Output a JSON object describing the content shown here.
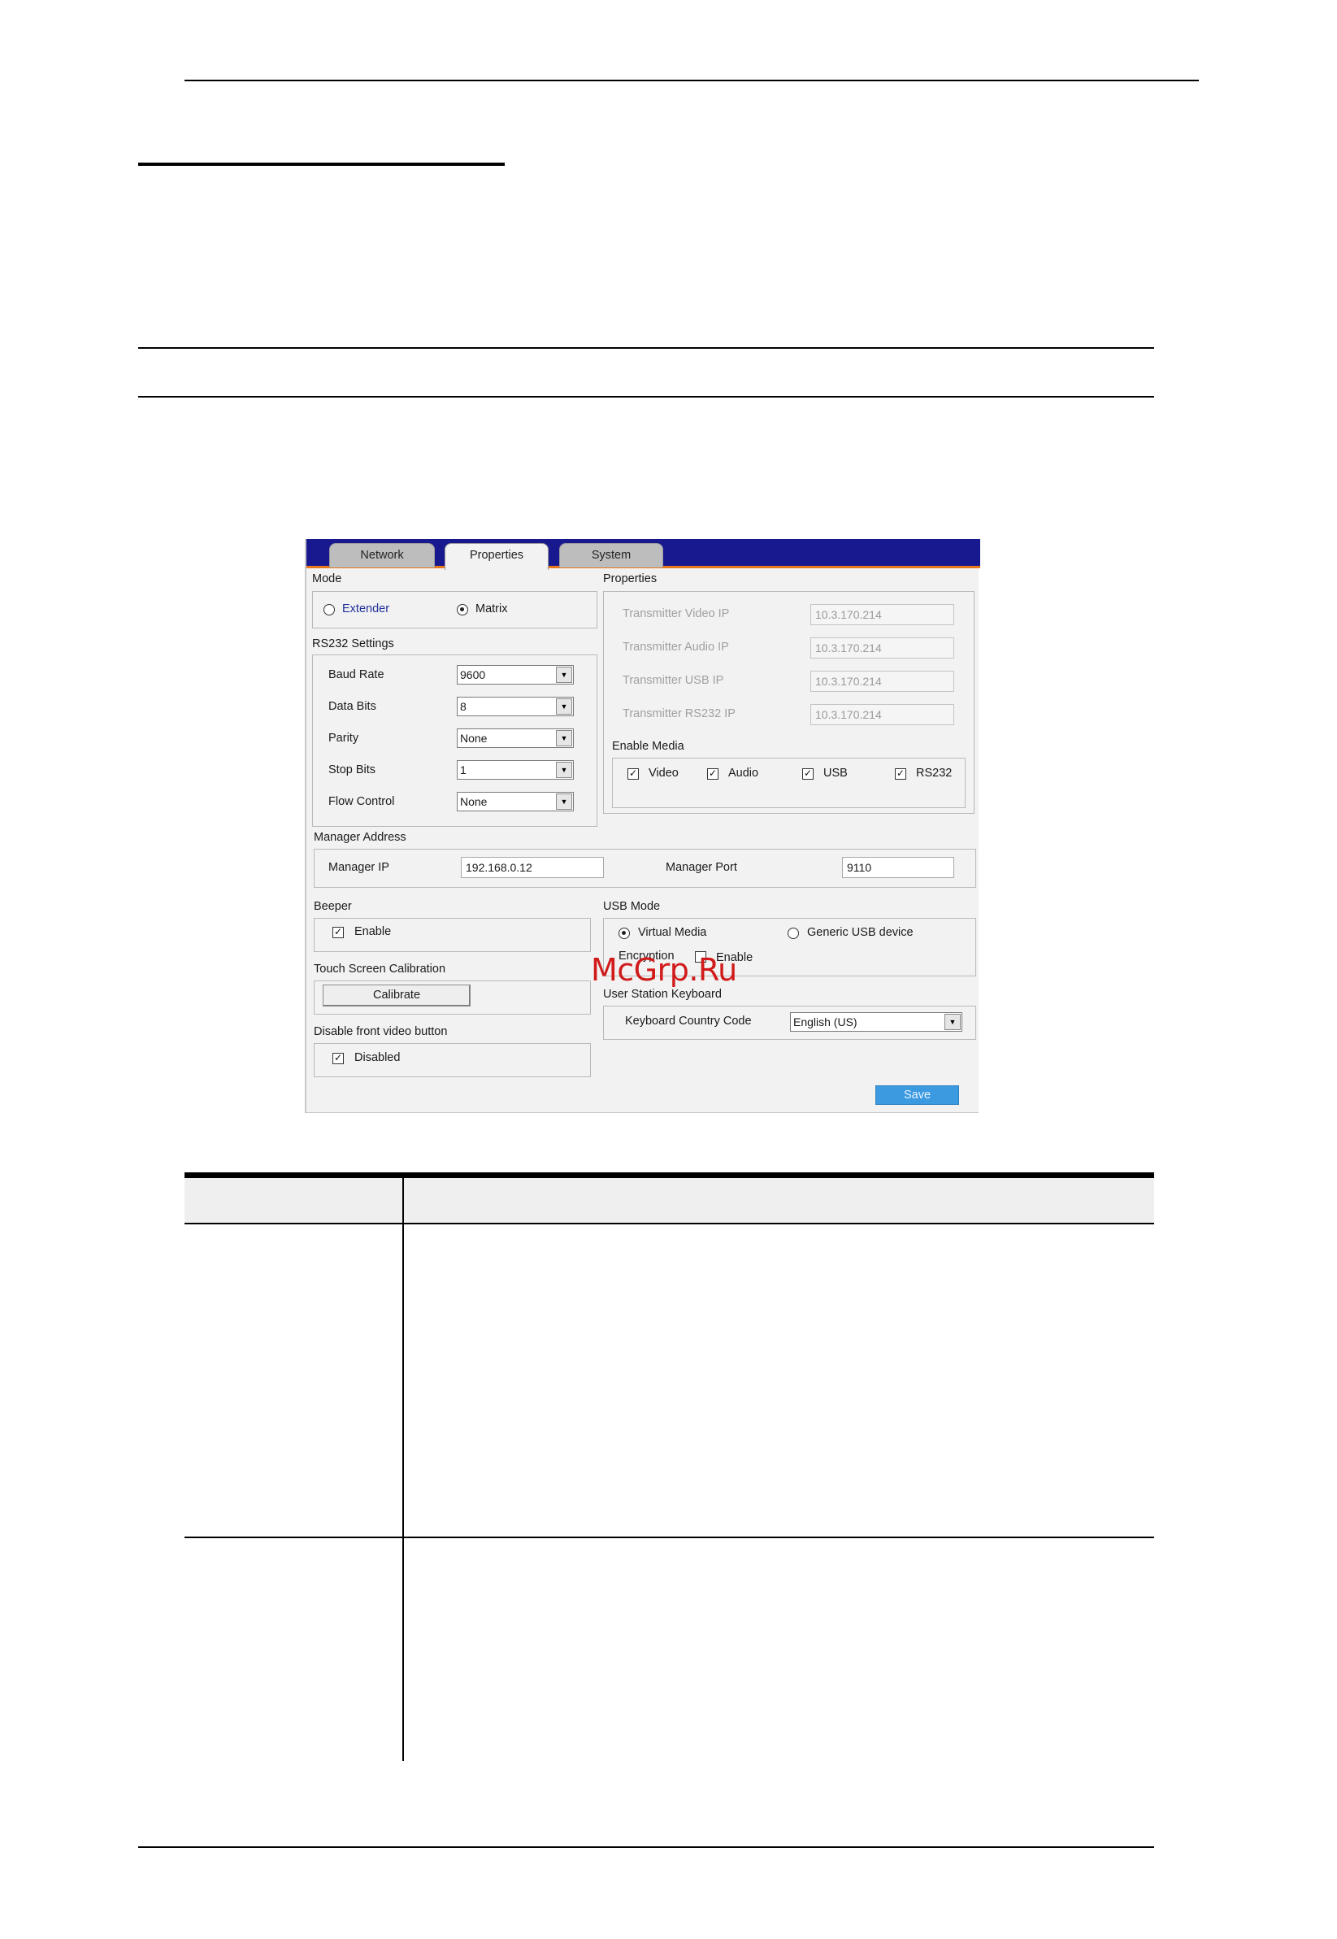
{
  "tabs": [
    {
      "label": "Network",
      "active": false
    },
    {
      "label": "Properties",
      "active": true
    },
    {
      "label": "System",
      "active": false
    }
  ],
  "mode": {
    "title": "Mode",
    "options": [
      {
        "label": "Extender",
        "selected": false
      },
      {
        "label": "Matrix",
        "selected": true
      }
    ]
  },
  "rs232": {
    "title": "RS232 Settings",
    "rows": [
      {
        "label": "Baud Rate",
        "value": "9600"
      },
      {
        "label": "Data Bits",
        "value": "8"
      },
      {
        "label": "Parity",
        "value": "None"
      },
      {
        "label": "Stop Bits",
        "value": "1"
      },
      {
        "label": "Flow Control",
        "value": "None"
      }
    ]
  },
  "properties": {
    "title": "Properties",
    "rows": [
      {
        "label": "Transmitter Video IP",
        "value": "10.3.170.214"
      },
      {
        "label": "Transmitter Audio IP",
        "value": "10.3.170.214"
      },
      {
        "label": "Transmitter USB IP",
        "value": "10.3.170.214"
      },
      {
        "label": "Transmitter RS232 IP",
        "value": "10.3.170.214"
      }
    ]
  },
  "enable_media": {
    "title": "Enable Media",
    "items": [
      {
        "label": "Video",
        "checked": true
      },
      {
        "label": "Audio",
        "checked": true
      },
      {
        "label": "USB",
        "checked": true
      },
      {
        "label": "RS232",
        "checked": true
      }
    ]
  },
  "manager": {
    "title": "Manager Address",
    "ip_label": "Manager IP",
    "ip_value": "192.168.0.12",
    "port_label": "Manager Port",
    "port_value": "9110"
  },
  "beeper": {
    "title": "Beeper",
    "label": "Enable",
    "checked": true
  },
  "usb_mode": {
    "title": "USB Mode",
    "options": [
      {
        "label": "Virtual Media",
        "selected": true
      },
      {
        "label": "Generic USB device",
        "selected": false
      }
    ],
    "encryption_label": "Encryption",
    "encryption_enable_label": "Enable",
    "encryption_checked": false
  },
  "touch": {
    "title": "Touch Screen Calibration",
    "button": "Calibrate"
  },
  "keyboard": {
    "title": "User Station Keyboard",
    "label": "Keyboard Country Code",
    "value": "English (US)"
  },
  "front_video": {
    "title": "Disable front video button",
    "label": "Disabled",
    "checked": true
  },
  "save_label": "Save",
  "watermark": "McGrp.Ru",
  "check_glyph": "✓",
  "dropdown_glyph": "▼"
}
